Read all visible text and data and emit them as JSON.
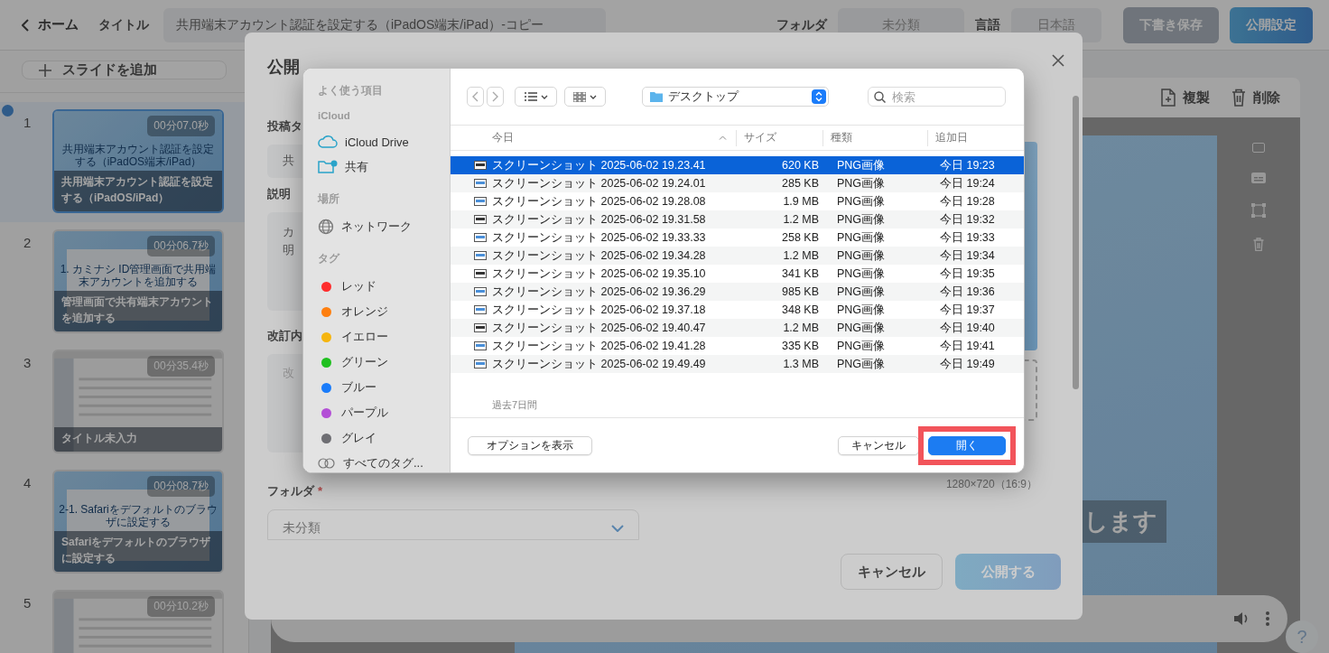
{
  "top_bar": {
    "back_label": "ホーム",
    "title_label": "タイトル",
    "title_value": "共用端末アカウント認証を設定する（iPadOS端末/iPad）-コピー",
    "folder_label": "フォルダ",
    "folder_value": "未分類",
    "language_label": "言語",
    "language_value": "日本語",
    "buttons": [
      {
        "label": "下書き保存",
        "kind": "secondary"
      },
      {
        "label": "公開設定",
        "kind": "primary"
      }
    ]
  },
  "slides_panel": {
    "add_button": "スライドを追加",
    "slides": [
      {
        "number": "1",
        "duration": "00分07.0秒",
        "title": "共用端末アカウント認証を設定する（iPadOS/iPad）",
        "thumbnail_text": "共用端末アカウント認証を設定する（iPadOS端末/iPad）",
        "kind": "cover",
        "selected": true
      },
      {
        "number": "2",
        "duration": "00分06.7秒",
        "title": "管理画面で共有端末アカウントを追加する",
        "thumbnail_text": "1. カミナシ ID管理画面で共用端末アカウントを追加する",
        "kind": "section",
        "selected": false
      },
      {
        "number": "3",
        "duration": "00分35.4秒",
        "title": "タイトル未入力",
        "kind": "screenshot",
        "selected": false
      },
      {
        "number": "4",
        "duration": "00分08.7秒",
        "title": "Safariをデフォルトのブラウザに設定する",
        "thumbnail_text": "2-1. Safariをデフォルトのブラウザに設定する",
        "kind": "section",
        "selected": false
      },
      {
        "number": "5",
        "duration": "00分10.2秒",
        "kind": "screenshot",
        "selected": false
      }
    ]
  },
  "editor": {
    "actions": [
      {
        "label": "複製",
        "kind": "duplicate"
      },
      {
        "label": "削除",
        "kind": "delete"
      }
    ],
    "caption": "します",
    "help_label": "?"
  },
  "modal": {
    "title": "公開",
    "fields": [
      {
        "kind": "input",
        "label": "投稿タ",
        "value": "共"
      },
      {
        "kind": "textarea",
        "label": "説明",
        "lines": [
          "カ",
          "明"
        ]
      },
      {
        "kind": "textarea",
        "label": "改訂内",
        "placeholder": "改"
      },
      {
        "kind": "select",
        "label": "フォルダ",
        "required_mark": "*",
        "value": "未分類"
      }
    ],
    "image_size": "1280×720（16:9）",
    "buttons": [
      {
        "label": "キャンセル",
        "kind": "secondary"
      },
      {
        "label": "公開する",
        "kind": "primary"
      }
    ]
  },
  "file_dialog": {
    "sidebar": [
      {
        "heading": "よく使う項目"
      },
      {
        "heading": "iCloud",
        "items": [
          {
            "label": "iCloud Drive",
            "kind": "cloud"
          },
          {
            "label": "共有",
            "kind": "shared"
          }
        ]
      },
      {
        "heading": "場所",
        "items": [
          {
            "label": "ネットワーク",
            "kind": "network"
          }
        ]
      },
      {
        "heading": "タグ",
        "items": [
          {
            "label": "レッド",
            "kind": "tag",
            "color": "#fe2d2d"
          },
          {
            "label": "オレンジ",
            "kind": "tag",
            "color": "#fe7f0f"
          },
          {
            "label": "イエロー",
            "kind": "tag",
            "color": "#f5b50f"
          },
          {
            "label": "グリーン",
            "kind": "tag",
            "color": "#20c020"
          },
          {
            "label": "ブルー",
            "kind": "tag",
            "color": "#1a7cfa"
          },
          {
            "label": "パープル",
            "kind": "tag",
            "color": "#b34fd6"
          },
          {
            "label": "グレイ",
            "kind": "tag",
            "color": "#6e6e73"
          },
          {
            "label": "すべてのタグ...",
            "kind": "all-tags"
          }
        ]
      }
    ],
    "location": "デスクトップ",
    "search_placeholder": "検索",
    "columns": [
      "今日",
      "サイズ",
      "種類",
      "追加日"
    ],
    "rows": [
      {
        "name": "スクリーンショット 2025-06-02 19.23.41",
        "size": "620 KB",
        "type": "PNG画像",
        "date": "今日 19:23",
        "selected": true
      },
      {
        "name": "スクリーンショット 2025-06-02 19.24.01",
        "size": "285 KB",
        "type": "PNG画像",
        "date": "今日 19:24",
        "selected": false
      },
      {
        "name": "スクリーンショット 2025-06-02 19.28.08",
        "size": "1.9 MB",
        "type": "PNG画像",
        "date": "今日 19:28",
        "selected": false
      },
      {
        "name": "スクリーンショット 2025-06-02 19.31.58",
        "size": "1.2 MB",
        "type": "PNG画像",
        "date": "今日 19:32",
        "selected": false
      },
      {
        "name": "スクリーンショット 2025-06-02 19.33.33",
        "size": "258 KB",
        "type": "PNG画像",
        "date": "今日 19:33",
        "selected": false
      },
      {
        "name": "スクリーンショット 2025-06-02 19.34.28",
        "size": "1.2 MB",
        "type": "PNG画像",
        "date": "今日 19:34",
        "selected": false
      },
      {
        "name": "スクリーンショット 2025-06-02 19.35.10",
        "size": "341 KB",
        "type": "PNG画像",
        "date": "今日 19:35",
        "selected": false
      },
      {
        "name": "スクリーンショット 2025-06-02 19.36.29",
        "size": "985 KB",
        "type": "PNG画像",
        "date": "今日 19:36",
        "selected": false
      },
      {
        "name": "スクリーンショット 2025-06-02 19.37.18",
        "size": "348 KB",
        "type": "PNG画像",
        "date": "今日 19:37",
        "selected": false
      },
      {
        "name": "スクリーンショット 2025-06-02 19.40.47",
        "size": "1.2 MB",
        "type": "PNG画像",
        "date": "今日 19:40",
        "selected": false
      },
      {
        "name": "スクリーンショット 2025-06-02 19.41.28",
        "size": "335 KB",
        "type": "PNG画像",
        "date": "今日 19:41",
        "selected": false
      },
      {
        "name": "スクリーンショット 2025-06-02 19.49.49",
        "size": "1.3 MB",
        "type": "PNG画像",
        "date": "今日 19:49",
        "selected": false
      }
    ],
    "group_label": "過去7日間",
    "buttons": [
      {
        "label": "オプションを表示",
        "kind": "options"
      },
      {
        "label": "キャンセル",
        "kind": "cancel"
      },
      {
        "label": "開く",
        "kind": "open",
        "highlighted": true
      }
    ]
  }
}
